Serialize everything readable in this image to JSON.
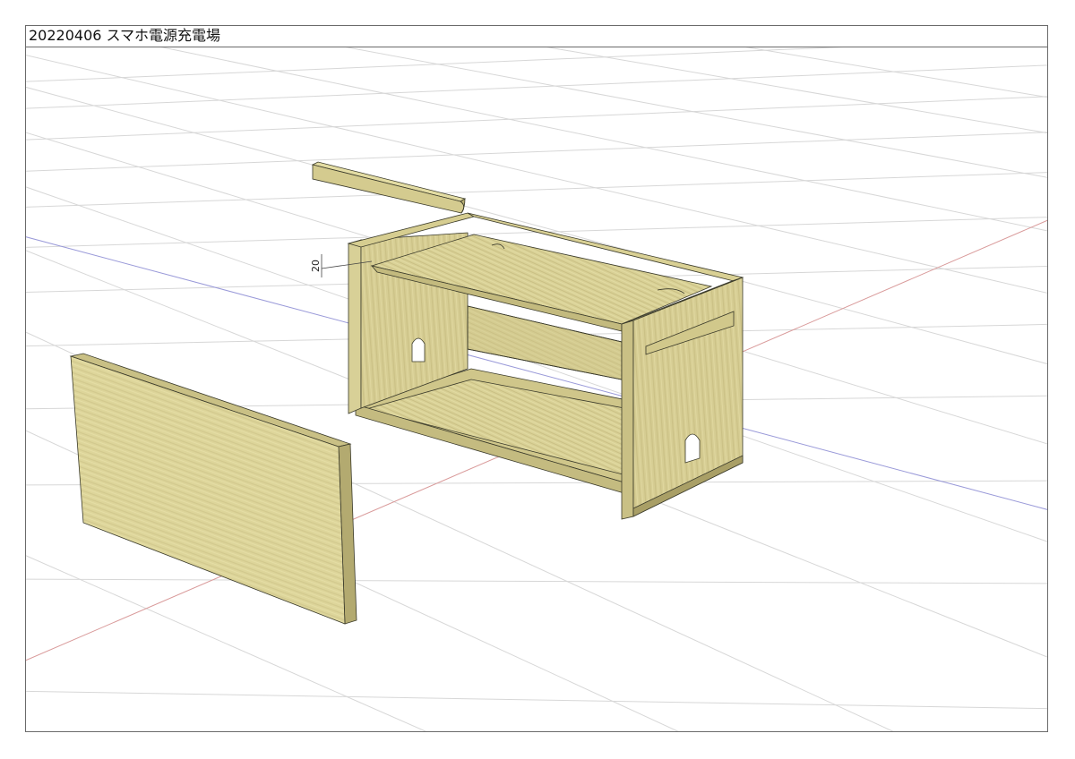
{
  "title": "20220406 スマホ電源充電場",
  "dimension_label": "20",
  "colors": {
    "border": "#6b6b6b",
    "grid": "#d4d4d4",
    "axis_red": "#d88a8a",
    "axis_blue": "#8a8ad8",
    "wood_light": "#e2dba0",
    "wood_mid": "#cfc68a",
    "wood_dark": "#b3aa70",
    "edge_line": "#3a3a2a"
  }
}
